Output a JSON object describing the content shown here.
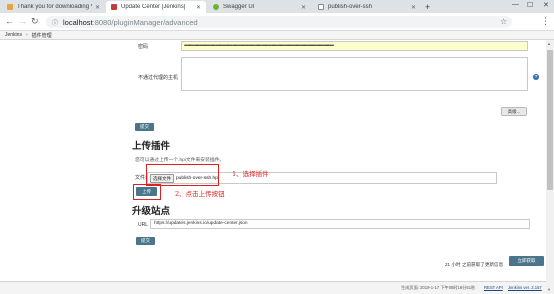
{
  "browser": {
    "tabs": [
      {
        "label": "Thank you for downloading V",
        "favicon_color": "#e8a33d"
      },
      {
        "label": "Update Center [Jenkins]",
        "favicon_color": "#c73a3a"
      },
      {
        "label": "Swagger UI",
        "favicon_color": "#6eb32f"
      },
      {
        "label": "publish-over-ssh",
        "favicon_color": "#8a8a8a"
      }
    ],
    "new_tab_label": "+",
    "url_host": "localhost",
    "url_path": ":8080/pluginManager/advanced"
  },
  "breadcrumb": {
    "root": "Jenkins",
    "separator": "›",
    "current": "插件管理"
  },
  "proxy": {
    "password_label": "密码",
    "password_value": "••••••••••••••••••••••••••••••••••••••••••••••••••••••••••••••••••••••••••••••••••••••••••••••••••••••••••••••••••••••••••••••••••",
    "no_proxy_label": "不通过代理的主机",
    "advanced_button": "高级...",
    "submit_button": "提交"
  },
  "upload": {
    "title": "上传插件",
    "description": "您可以通过上传一个.hpi文件来安装插件。",
    "file_label": "文件:",
    "choose_button": "选择文件",
    "filename": "publish-over-ssh.hpi",
    "upload_button": "上传",
    "annotation_1": "1、选择插件",
    "annotation_2": "2、点击上传按钮"
  },
  "update_site": {
    "title": "升级站点",
    "url_label": "URL",
    "url_value": "https://updates.jenkins.io/update-center.json",
    "submit_button": "提交",
    "last_updated": "21 小时 之前获取了更新信息",
    "check_now_button": "立即获取"
  },
  "footer": {
    "generated": "生成页面: 2019-1-17 下午08时18分51秒",
    "rest_api": "REST API",
    "version": "Jenkins ver. 2.157"
  },
  "colors": {
    "jenkins_button": "#4b758b",
    "annotation_red": "#e02020",
    "password_bg": "#ffffcc"
  }
}
